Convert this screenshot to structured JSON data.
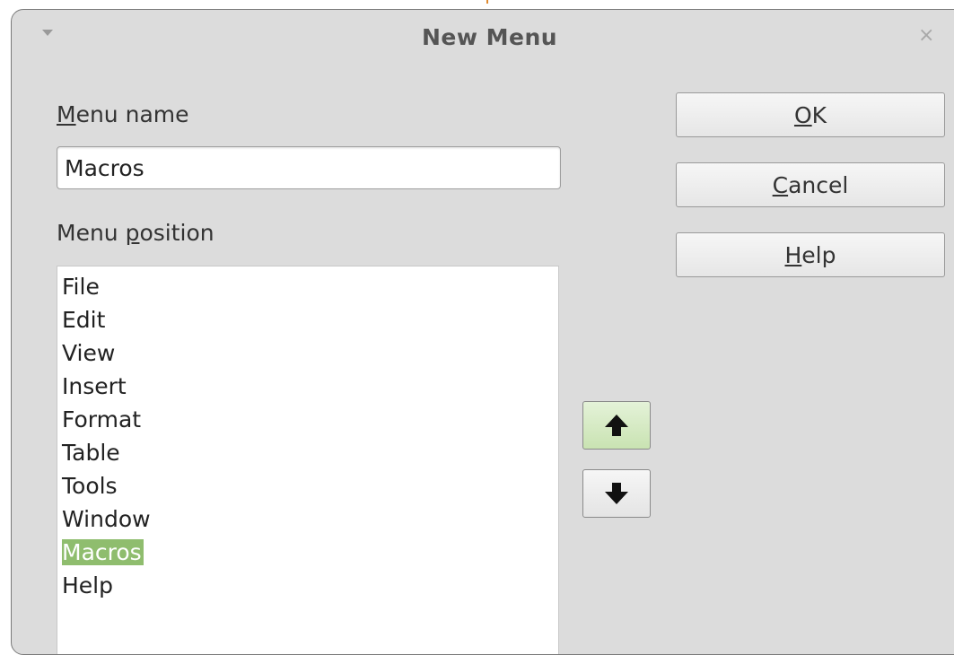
{
  "window": {
    "title": "New Menu",
    "menu_icon": "chevron-down-icon",
    "close_icon": "close-icon",
    "close_glyph": "×"
  },
  "menu_name": {
    "label_mnemonic": "M",
    "label_rest": "enu name",
    "value": "Macros"
  },
  "menu_position": {
    "label_pre": "Menu ",
    "label_mnemonic": "p",
    "label_rest": "osition",
    "items": [
      "File",
      "Edit",
      "View",
      "Insert",
      "Format",
      "Table",
      "Tools",
      "Window",
      "Macros",
      "Help"
    ],
    "selected": "Macros"
  },
  "buttons": {
    "ok": {
      "mnemonic": "O",
      "rest": "K"
    },
    "cancel": {
      "mnemonic": "C",
      "rest": "ancel"
    },
    "help": {
      "mnemonic": "H",
      "rest": "elp"
    },
    "move_up_icon": "arrow-up-icon",
    "move_down_icon": "arrow-down-icon"
  },
  "colors": {
    "dialog_bg": "#dcdcdc",
    "selection": "#8fbd6e",
    "up_button": "#c9e3b2"
  }
}
